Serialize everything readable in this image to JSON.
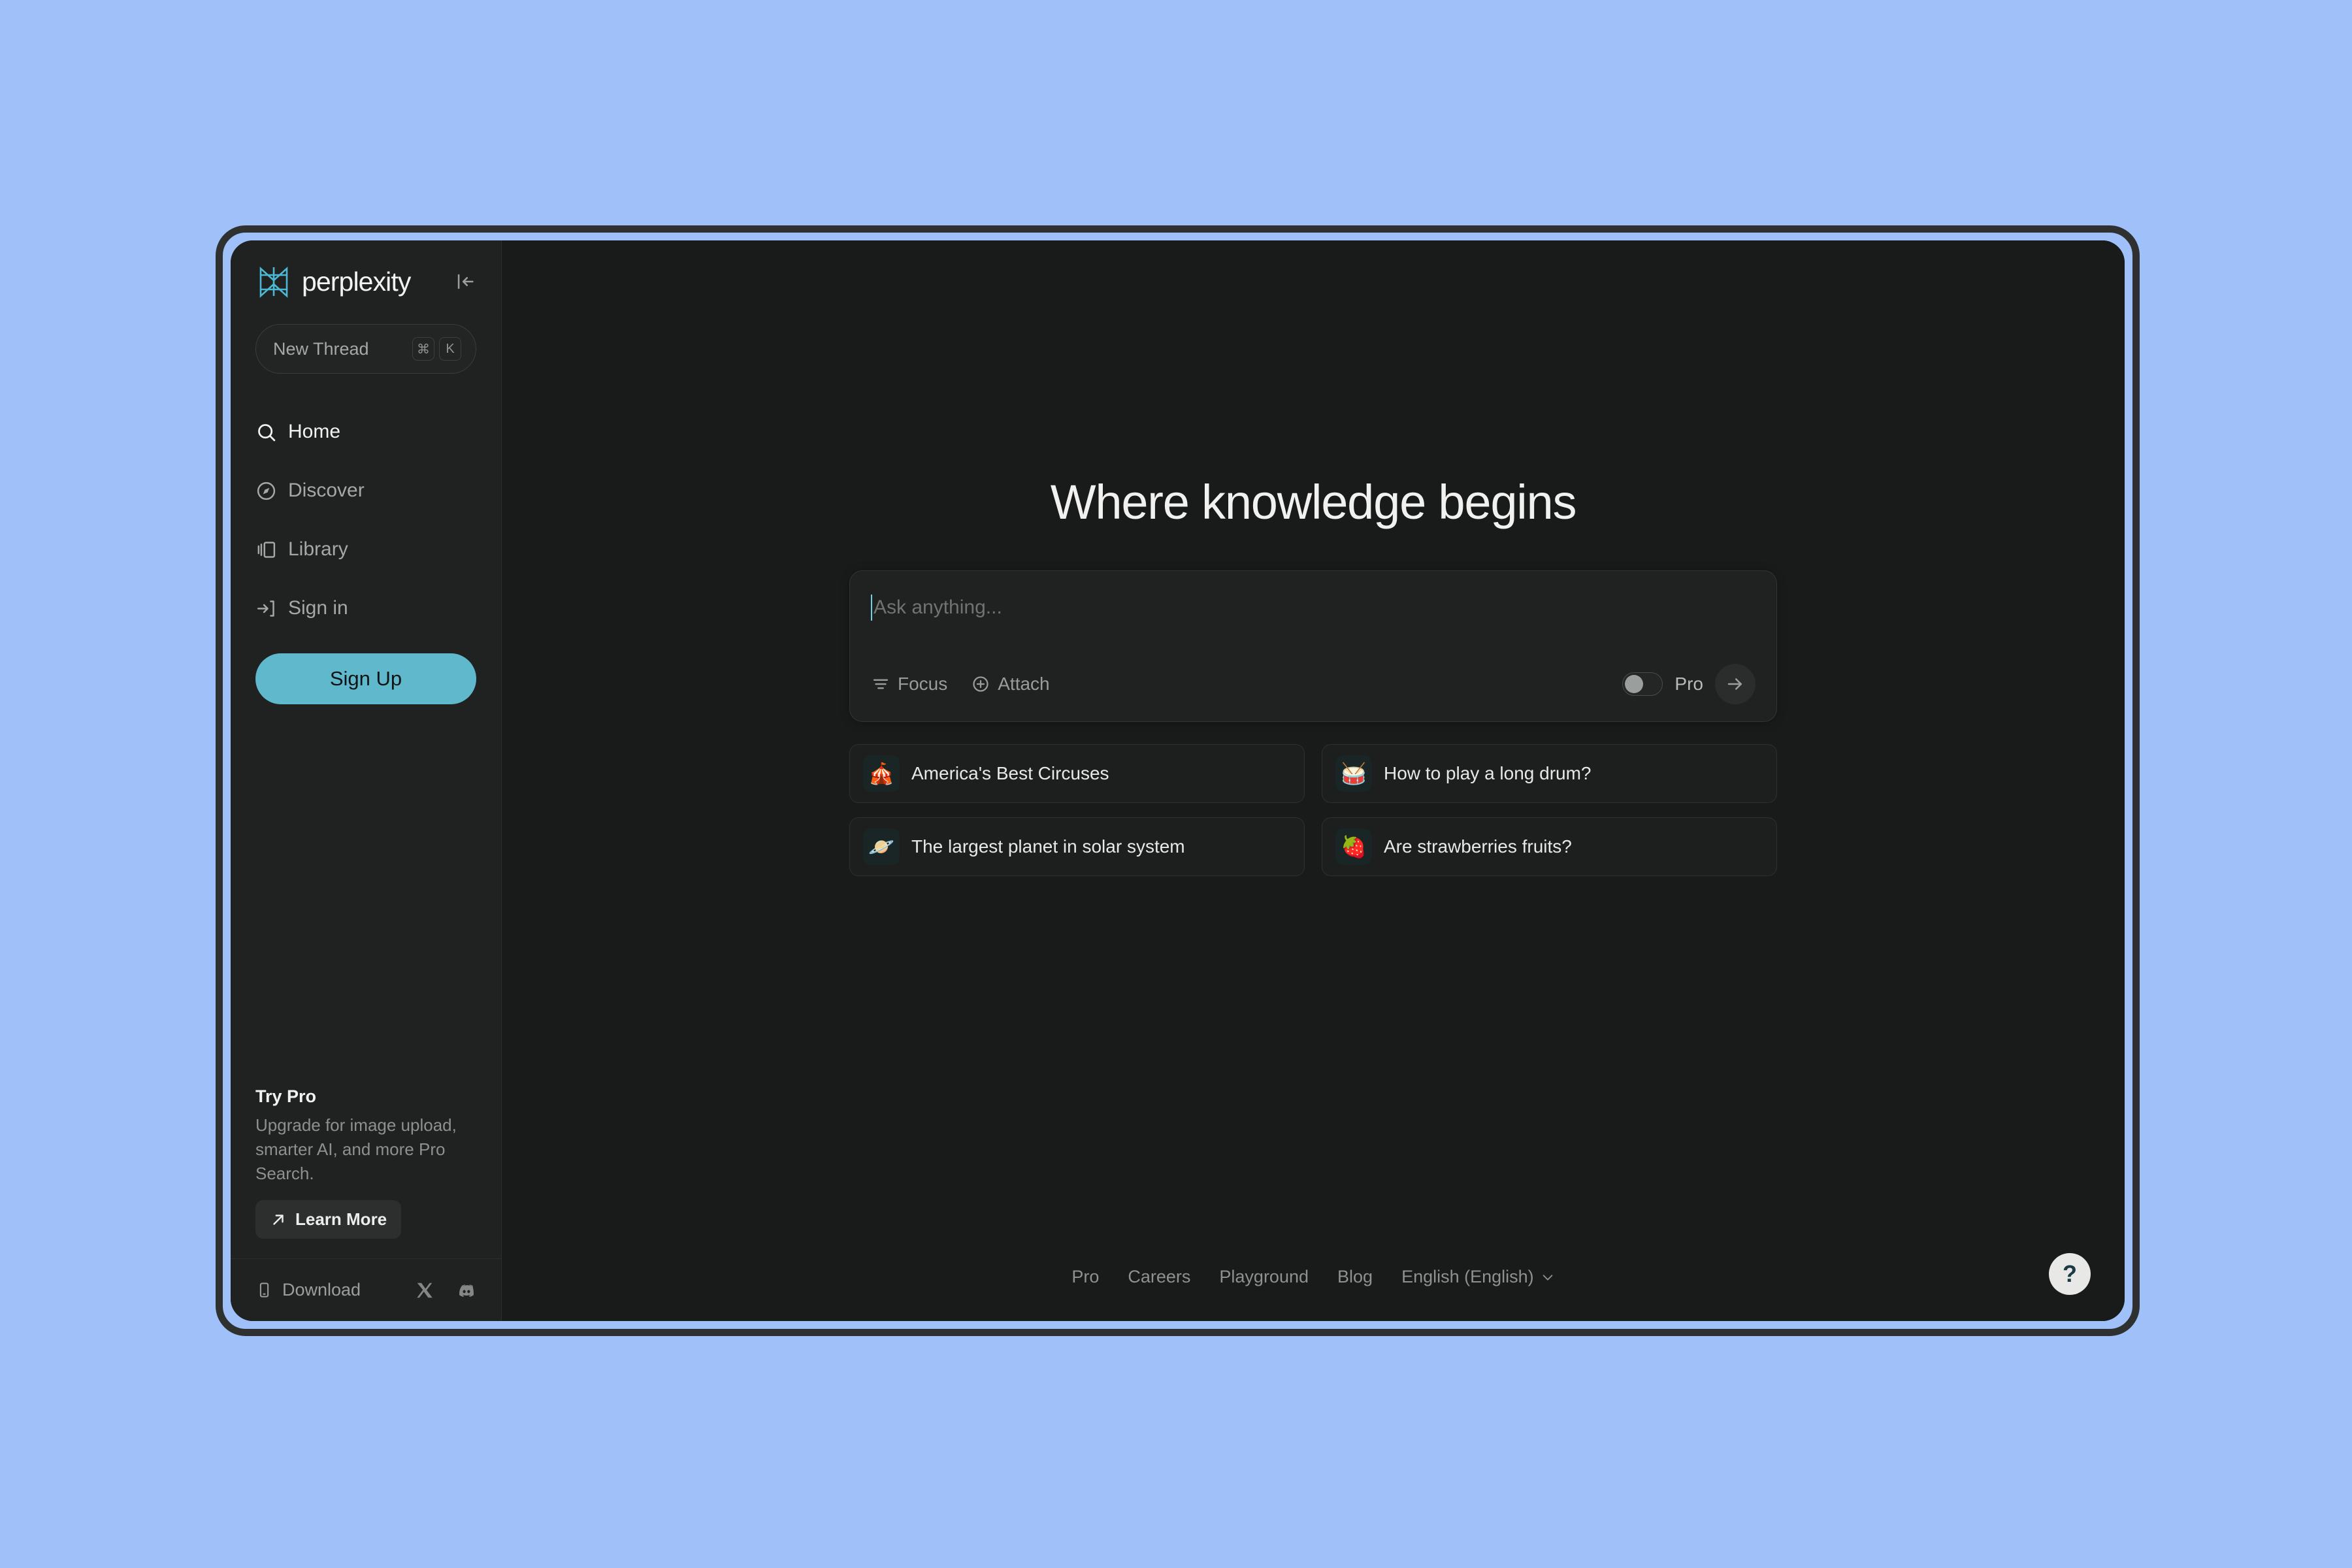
{
  "theme": {
    "page_background": "#9fc0f8",
    "window_border": "#2f3131",
    "sidebar_background": "#202222",
    "main_background": "#191a1a",
    "accent_teal": "#5fb8cc",
    "logo_teal": "#4db8d4"
  },
  "sidebar": {
    "brand_name": "perplexity",
    "collapse_icon": "collapse-sidebar-icon",
    "new_thread": {
      "label": "New Thread",
      "shortcut_modifier": "⌘",
      "shortcut_key": "K"
    },
    "nav": [
      {
        "label": "Home",
        "icon": "search-icon",
        "active": true
      },
      {
        "label": "Discover",
        "icon": "compass-icon",
        "active": false
      },
      {
        "label": "Library",
        "icon": "library-icon",
        "active": false
      },
      {
        "label": "Sign in",
        "icon": "sign-in-icon",
        "active": false
      }
    ],
    "signup_label": "Sign Up",
    "try_pro": {
      "title": "Try Pro",
      "description": "Upgrade for image upload, smarter AI, and more Pro Search.",
      "button_label": "Learn More",
      "button_icon": "arrow-up-right-icon"
    },
    "footer": {
      "download_label": "Download",
      "download_icon": "mobile-device-icon",
      "socials": [
        {
          "name": "x-twitter-icon"
        },
        {
          "name": "discord-icon"
        }
      ]
    }
  },
  "main": {
    "headline": "Where knowledge begins",
    "search": {
      "placeholder": "Ask anything...",
      "value": "",
      "focus_label": "Focus",
      "focus_icon": "filter-icon",
      "attach_label": "Attach",
      "attach_icon": "plus-circle-icon",
      "pro_label": "Pro",
      "pro_enabled": false,
      "submit_icon": "arrow-right-icon"
    },
    "suggestions": [
      {
        "emoji": "🎪",
        "label": "America's Best Circuses",
        "icon": "circus-tent-icon"
      },
      {
        "emoji": "🥁",
        "label": "How to play a long drum?",
        "icon": "drum-icon"
      },
      {
        "emoji": "🪐",
        "label": "The largest planet in solar system",
        "icon": "ringed-planet-icon"
      },
      {
        "emoji": "🍓",
        "label": "Are strawberries fruits?",
        "icon": "strawberry-icon"
      }
    ],
    "footer": {
      "links": [
        "Pro",
        "Careers",
        "Playground",
        "Blog"
      ],
      "language": "English (English)",
      "language_chevron": "chevron-down-icon"
    },
    "help_label": "?"
  }
}
